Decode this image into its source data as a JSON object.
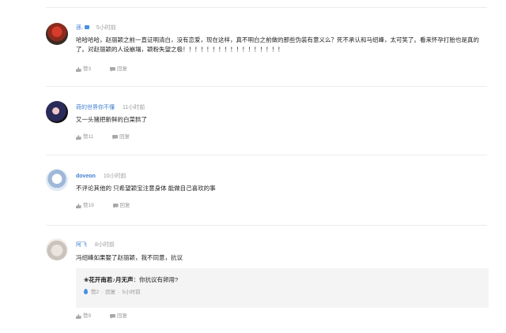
{
  "comments": [
    {
      "username": "孫.",
      "time": "5小时前",
      "text": "哈哈哈哈，赵丽颖之前一直证明清白，没有恋爱，现在这样，真不明白之前做的那些伪装有意义么？死不承认和马绍峰，太可笑了。看来怀孕打胎也是真的了。对赵丽颖的人设崩塌，颖粉失望之极！！！！！！！！！！！！！！！！！",
      "likes": "赞3",
      "reply": "回复"
    },
    {
      "username": "荷的世界你不懂",
      "time": "11小时前",
      "text": "又一头猪把新鲜的白菜拱了",
      "likes": "赞11",
      "reply": "回复"
    },
    {
      "username": "doveon",
      "time": "10小时前",
      "text": "不评论其他的 只希望颖宝注意身体 能做自己喜欢的事",
      "likes": "赞19",
      "reply": "回复"
    },
    {
      "username": "阿飞",
      "time": "8小时前",
      "text": "冯绍峰如果娶了赵丽颖，我不同意，抗议",
      "likes": "赞9",
      "reply": "回复",
      "sub_reply": {
        "username": "❀花开南若♪月无声",
        "colon": "：",
        "text": "你抗议有卵用?",
        "likes": "赞2",
        "reply": "回复",
        "time": "5小时前",
        "dot": "·"
      }
    }
  ],
  "colors": {
    "username": "#3f7fd1",
    "meta": "#9a9a9a",
    "background": "#ffffff",
    "reply_bg": "#f4f4f4"
  },
  "icons": {
    "like": "thumb-up-icon",
    "reply": "speech-bubble-icon",
    "vip": "vip-badge-icon",
    "hot": "flame-icon"
  }
}
